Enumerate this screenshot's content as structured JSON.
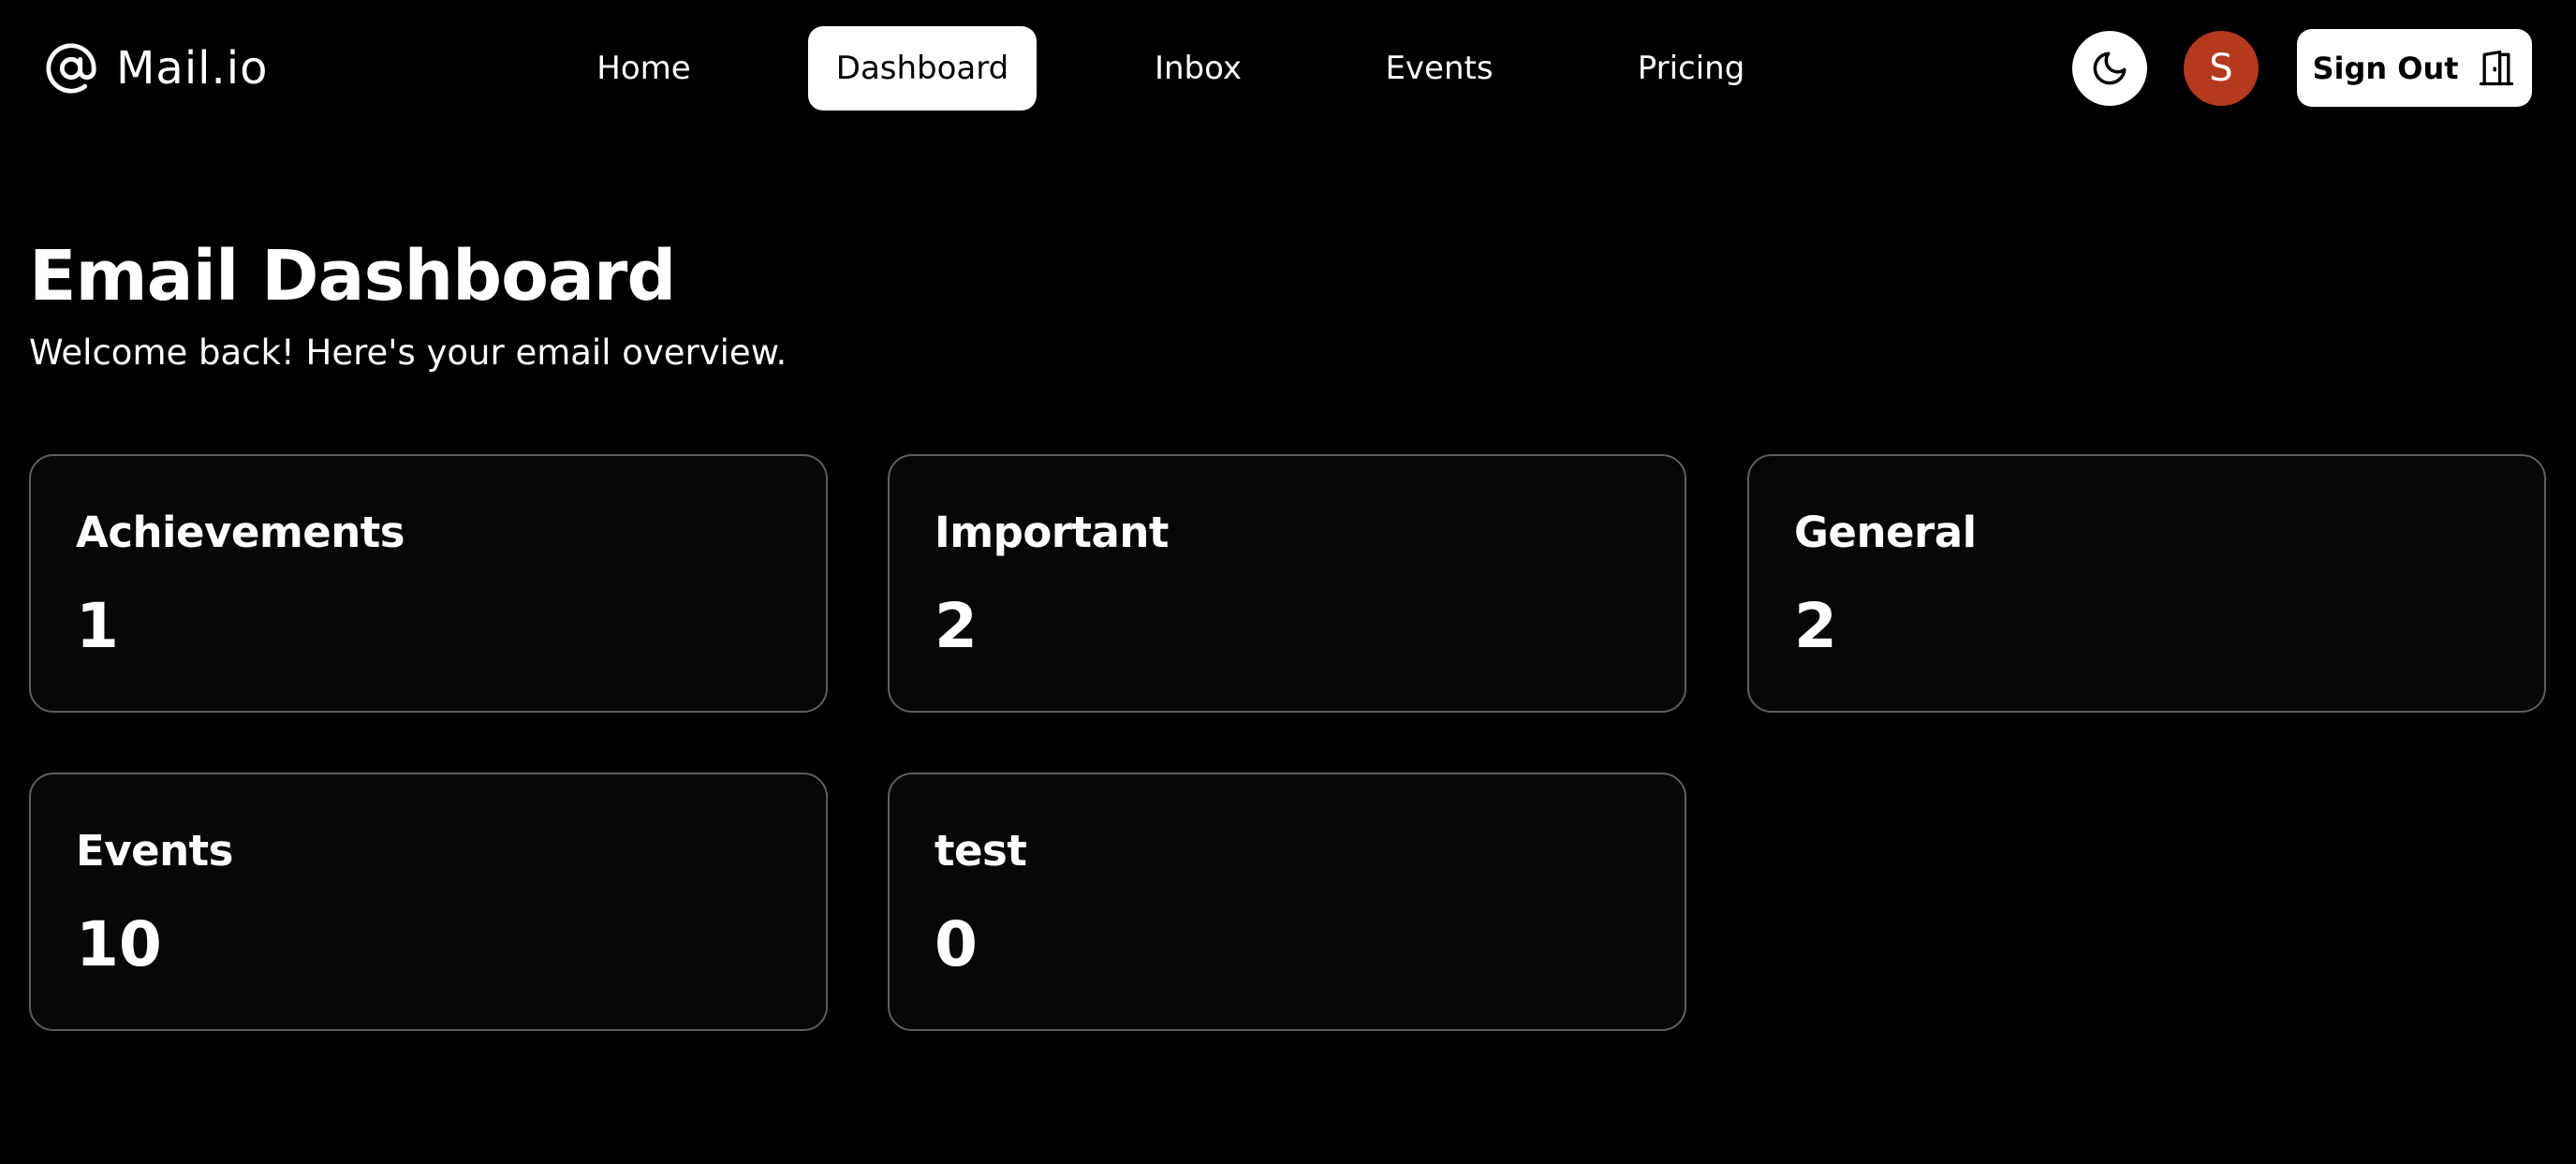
{
  "brand": {
    "name": "Mail.io",
    "icon": "at-sign-icon"
  },
  "nav": {
    "items": [
      {
        "label": "Home",
        "active": false
      },
      {
        "label": "Dashboard",
        "active": true
      },
      {
        "label": "Inbox",
        "active": false
      },
      {
        "label": "Events",
        "active": false
      },
      {
        "label": "Pricing",
        "active": false
      }
    ]
  },
  "actions": {
    "theme_toggle_icon": "moon-icon",
    "avatar_initial": "S",
    "avatar_color": "#b5391f",
    "sign_out_label": "Sign Out",
    "sign_out_icon": "door-icon"
  },
  "header": {
    "title": "Email Dashboard",
    "subtitle": "Welcome back! Here's your email overview."
  },
  "stats": [
    {
      "label": "Achievements",
      "value": "1"
    },
    {
      "label": "Important",
      "value": "2"
    },
    {
      "label": "General",
      "value": "2"
    },
    {
      "label": "Events",
      "value": "10"
    },
    {
      "label": "test",
      "value": "0"
    }
  ]
}
